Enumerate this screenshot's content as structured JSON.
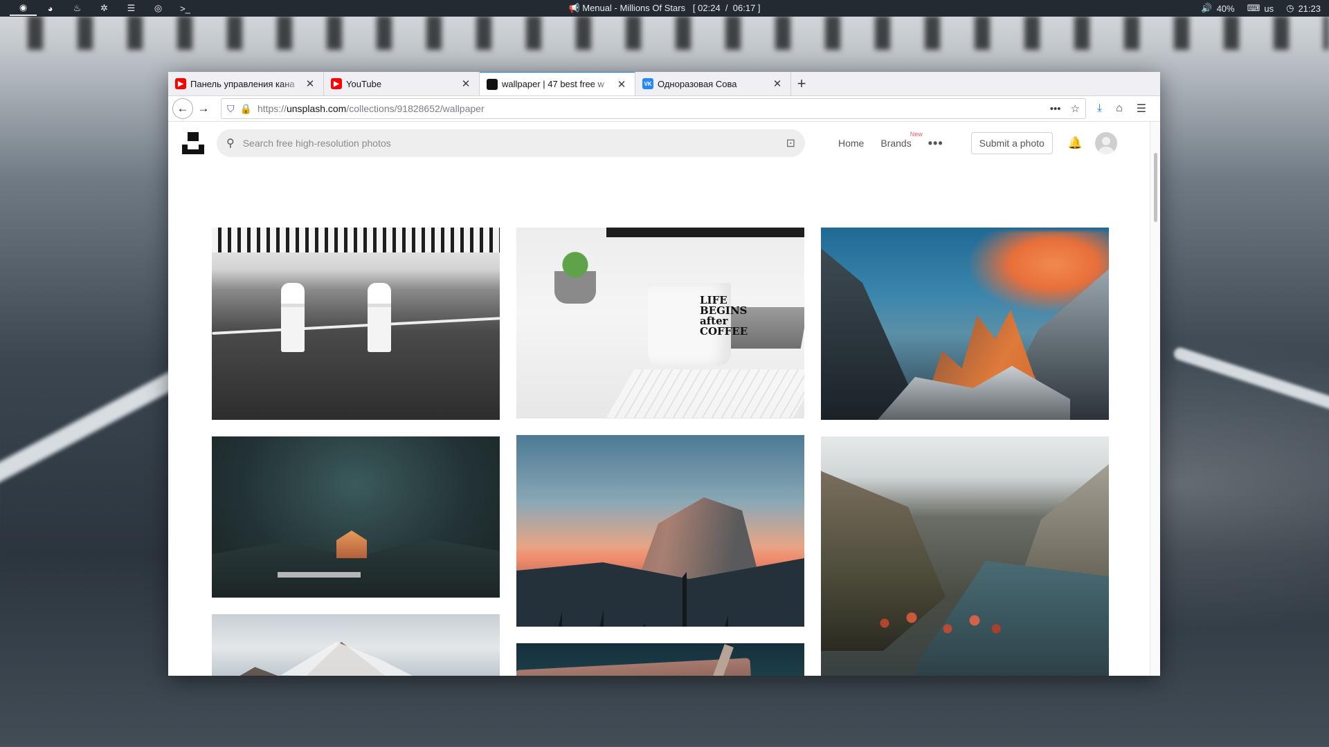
{
  "panel": {
    "now_playing": "Menual - Millions Of Stars",
    "elapsed": "[ 02:24",
    "separator": "/",
    "duration": "06:17 ]",
    "volume": "40%",
    "keyboard_layout": "us",
    "clock": "21:23",
    "launcher_icons": [
      "app-menu-icon",
      "app-icon-2",
      "flame-icon",
      "apps-icon",
      "files-icon",
      "chrome-icon",
      "terminal-icon"
    ],
    "terminal_glyph": ">_"
  },
  "tabs": [
    {
      "title": "Панель управления кана",
      "favicon": "youtube",
      "active": false
    },
    {
      "title": "YouTube",
      "favicon": "youtube",
      "active": false
    },
    {
      "title": "wallpaper | 47 best free w",
      "favicon": "unsplash",
      "active": true
    },
    {
      "title": "Одноразовая Сова",
      "favicon": "vk",
      "active": false
    }
  ],
  "favicon_text": {
    "youtube": "▶",
    "vk": "VK"
  },
  "url": {
    "scheme": "https://",
    "host": "unsplash.com",
    "path": "/collections/91828652/wallpaper"
  },
  "site": {
    "search_placeholder": "Search free high-resolution photos",
    "nav": {
      "home": "Home",
      "brands": "Brands",
      "brands_badge": "New"
    },
    "submit": "Submit a photo"
  },
  "photos": {
    "mug_text": "LIFE\nBEGINS\nafter\nCOFFEE"
  },
  "colors": {
    "panel_bg": "#232a31",
    "tab_accent": "#0a84ff",
    "youtube_red": "#ff0000",
    "vk_blue": "#2787f5",
    "new_badge": "#e25c5c"
  }
}
